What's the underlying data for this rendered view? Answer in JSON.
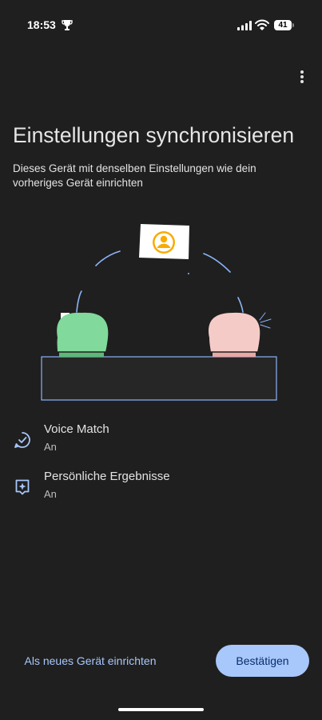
{
  "status_bar": {
    "time": "18:53",
    "battery": "41"
  },
  "header": {
    "title": "Einstellungen synchronisieren",
    "subtitle": "Dieses Gerät mit denselben Einstellungen wie dein vorheriges Gerät einrichten",
    "menu_icon": "more-vert-icon"
  },
  "settings": [
    {
      "title": "Voice Match",
      "status": "An",
      "icon": "voice-match-check-icon"
    },
    {
      "title": "Persönliche Ergebnisse",
      "status": "An",
      "icon": "personal-results-sparkle-icon"
    }
  ],
  "footer": {
    "secondary_label": "Als neues Gerät einrichten",
    "primary_label": "Bestätigen"
  },
  "colors": {
    "background": "#1f1f1f",
    "accent": "#a8c7fa",
    "accent_text": "#062e6f",
    "speaker_left": "#81d99b",
    "speaker_right": "#f5cbc8",
    "avatar": "#f9ab00"
  }
}
